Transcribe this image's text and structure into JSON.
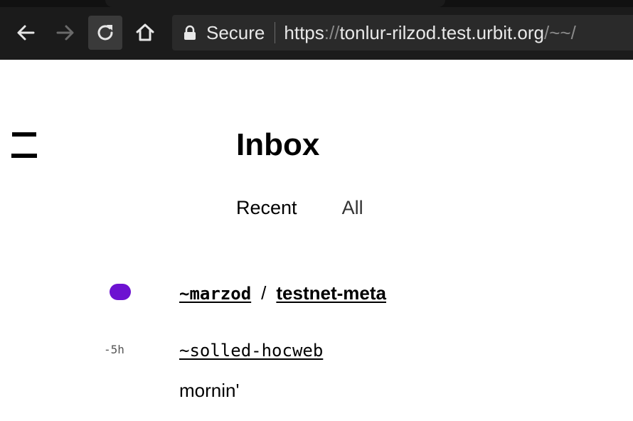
{
  "browser": {
    "secure_label": "Secure",
    "url_scheme": "https",
    "url_sep": "://",
    "url_host": "tonlur-rilzod.test.urbit.org",
    "url_path": "/~~/"
  },
  "page": {
    "title": "Inbox",
    "tabs": [
      {
        "label": "Recent",
        "active": true
      },
      {
        "label": "All",
        "active": false
      }
    ]
  },
  "inbox": {
    "circle": {
      "host": "~marzod",
      "separator": "/",
      "name": "testnet-meta",
      "unread_color": "#6d12d1"
    },
    "message": {
      "age": "-5h",
      "author": "~solled-hocweb",
      "text": "mornin'"
    }
  },
  "colors": {
    "chrome_bg": "#1b1b1b",
    "omnibox_bg": "#2a2a2a",
    "accent": "#6d12d1"
  }
}
